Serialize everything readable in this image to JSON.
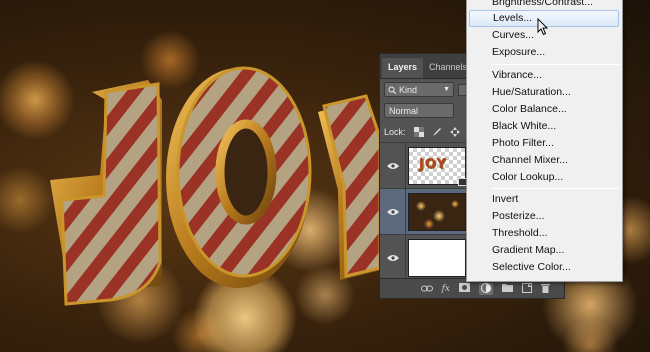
{
  "layers_panel": {
    "tabs": [
      "Layers",
      "Channels"
    ],
    "filter_kind": "Kind",
    "blend_mode": "Normal",
    "lock_label": "Lock:",
    "layers": [
      {
        "thumb": "text",
        "thumb_text": "JOY",
        "selected": false
      },
      {
        "thumb": "bokeh",
        "selected": true
      },
      {
        "thumb": "white",
        "selected": false
      }
    ],
    "footer_icons": [
      "link-icon",
      "fx-icon",
      "mask-icon",
      "adjustment-icon",
      "folder-icon",
      "new-layer-icon",
      "trash-icon"
    ],
    "footer_fx": "fx"
  },
  "adjustment_menu": {
    "items": [
      "Brightness/Contrast...",
      "Levels...",
      "Curves...",
      "Exposure...",
      "Vibrance...",
      "Hue/Saturation...",
      "Color Balance...",
      "Black  White...",
      "Photo Filter...",
      "Channel Mixer...",
      "Color Lookup...",
      "Invert",
      "Posterize...",
      "Threshold...",
      "Gradient Map...",
      "Selective Color..."
    ],
    "hovered": "Levels..."
  },
  "canvas": {
    "art_text": "JOY",
    "colors": {
      "gold": "#c8962a",
      "stripe_red": "#9a3326",
      "stripe_glitter": "#b8a888",
      "background": "#3a230c"
    }
  }
}
